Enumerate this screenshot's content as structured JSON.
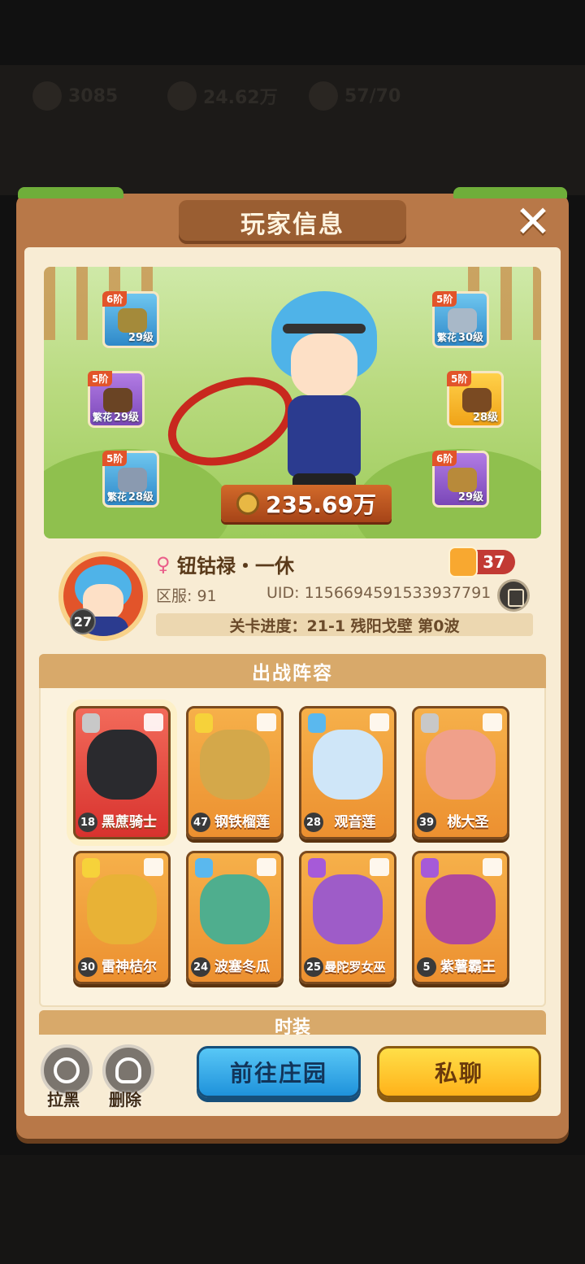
{
  "background": {
    "resources": [
      {
        "icon": "gem-icon",
        "value": "3085"
      },
      {
        "icon": "coin-icon",
        "value": "24.62万"
      },
      {
        "icon": "energy-icon",
        "value": "57/70"
      }
    ]
  },
  "panel": {
    "title": "玩家信息",
    "close_label": "✕"
  },
  "showcase": {
    "power": "235.69万",
    "equipment": [
      {
        "slot": "hat",
        "tier": "6阶",
        "level": "29级",
        "tag": "",
        "color": "blue"
      },
      {
        "slot": "gloves",
        "tier": "5阶",
        "level": "29级",
        "tag": "繁花",
        "color": "purple"
      },
      {
        "slot": "pants",
        "tier": "5阶",
        "level": "28级",
        "tag": "繁花",
        "color": "blue"
      },
      {
        "slot": "armor",
        "tier": "5阶",
        "level": "30级",
        "tag": "繁花",
        "color": "blue"
      },
      {
        "slot": "belt",
        "tier": "5阶",
        "level": "28级",
        "tag": "",
        "color": "gold"
      },
      {
        "slot": "boots",
        "tier": "6阶",
        "level": "29级",
        "tag": "",
        "color": "purple"
      }
    ]
  },
  "profile": {
    "name": "钮钴禄・一休",
    "gender": "♀",
    "likes": "37",
    "avatar_level": "27",
    "server": "区服: 91",
    "uid": "UID: 1156694591533937791",
    "progress": "关卡进度：21-1  残阳戈壁 第0波"
  },
  "lineup": {
    "title": "出战阵容",
    "heroes": [
      {
        "name": "黑蔗骑士",
        "level": "18",
        "element": "sword",
        "highlight": true
      },
      {
        "name": "钢铁榴莲",
        "level": "47",
        "element": "lightning",
        "highlight": false
      },
      {
        "name": "观音莲",
        "level": "28",
        "element": "water",
        "highlight": false
      },
      {
        "name": "桃大圣",
        "level": "39",
        "element": "sword",
        "highlight": false
      },
      {
        "name": "雷神桔尔",
        "level": "30",
        "element": "lightning",
        "highlight": false
      },
      {
        "name": "波塞冬瓜",
        "level": "24",
        "element": "water",
        "highlight": false
      },
      {
        "name": "曼陀罗女巫",
        "level": "25",
        "element": "poison",
        "highlight": false
      },
      {
        "name": "紫薯霸王",
        "level": "5",
        "element": "poison",
        "highlight": false
      }
    ]
  },
  "next_section_title": "时装",
  "actions": {
    "block": "拉黑",
    "delete": "删除",
    "visit": "前往庄园",
    "chat": "私聊"
  }
}
